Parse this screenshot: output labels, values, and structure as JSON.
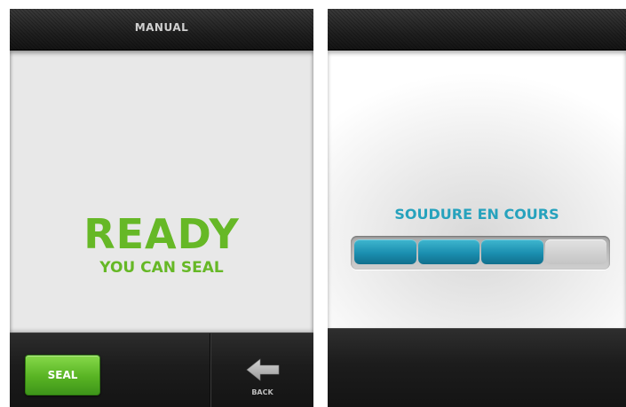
{
  "left_screen": {
    "title": "MANUAL",
    "status": "READY",
    "substatus": "YOU CAN SEAL",
    "seal_label": "SEAL",
    "back_label": "BACK",
    "back_icon": "arrow-left-icon"
  },
  "right_screen": {
    "title": "",
    "status": "SOUDURE EN COURS",
    "progress": {
      "segments_total": 4,
      "segments_filled": 3,
      "fraction": 0.75
    }
  },
  "colors": {
    "ready_green": "#66b826",
    "seal_button_green": "#58b323",
    "progress_teal": "#1b8fb0",
    "status_teal": "#26a2bd"
  }
}
